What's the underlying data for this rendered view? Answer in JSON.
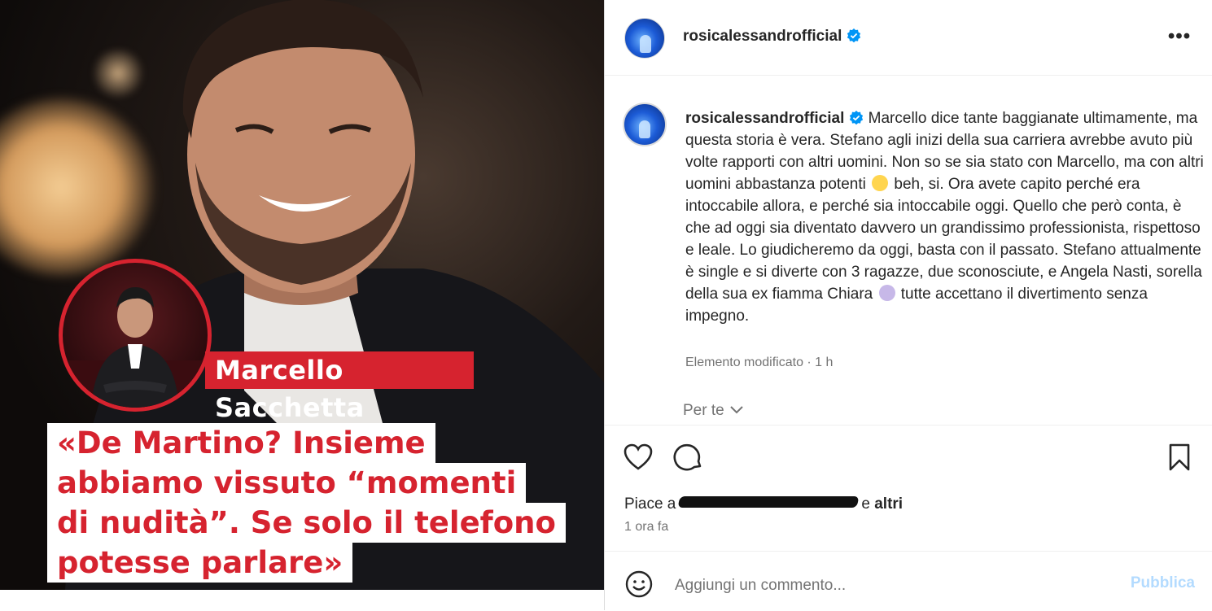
{
  "post": {
    "name_banner": "Marcello Sacchetta",
    "quote_lines": [
      "«De Martino? Insieme",
      "abbiamo vissuto “momenti",
      "di nudità”. Se solo il telefono",
      "potesse parlare»"
    ]
  },
  "header": {
    "username": "rosicalessandrofficial",
    "more_icon": "more-horizontal-icon"
  },
  "caption": {
    "username": "rosicalessandrofficial",
    "part1": "Marcello dice tante baggianate ultimamente, ma questa storia è vera. Stefano agli inizi della sua carriera avrebbe avuto più volte rapporti con altri uomini. Non so se sia stato con Marcello, ma con altri uomini abbastanza potenti",
    "part2": "beh, si. Ora avete capito perché era intoccabile allora, e perché sia intoccabile oggi. Quello che però conta, è che ad oggi sia diventato davvero un grandissimo professionista, rispettoso e leale. Lo giudicheremo da oggi, basta con il passato. Stefano attualmente è single e si diverte con 3 ragazze, due sconosciute, e Angela Nasti, sorella della sua ex fiamma Chiara",
    "part3": "tutte accettano il divertimento senza impegno.",
    "meta": "Elemento modificato · 1 h",
    "per_te": "Per te"
  },
  "actions": {
    "likes_prefix": "Piace a",
    "likes_and": "e",
    "likes_others": "altri",
    "time": "1 ora fa"
  },
  "comment": {
    "placeholder": "Aggiungi un commento...",
    "publish": "Pubblica"
  },
  "colors": {
    "accent_red": "#d6232f",
    "verified_blue": "#0095f6",
    "publish_disabled": "#b3dbff",
    "secondary_text": "#737373"
  }
}
